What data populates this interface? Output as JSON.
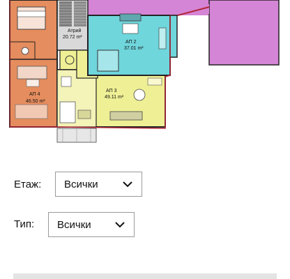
{
  "plan": {
    "rooms": [
      {
        "id": "stair",
        "name": "Атрий",
        "area": "20.72 m²"
      },
      {
        "id": "ap2",
        "name": "АП 2",
        "area": "37.01 m²"
      },
      {
        "id": "ap3",
        "name": "АП 3",
        "area": "49.11 m²"
      },
      {
        "id": "ap4",
        "name": "АП 4",
        "area": "46.50 m²"
      }
    ],
    "colors": {
      "orange": "#e58d5e",
      "pink": "#d585d6",
      "cyan": "#6fd6dc",
      "yellow": "#eff095",
      "wall": "#222222",
      "red_outline": "#b3283a",
      "stair": "#7d7d7d"
    }
  },
  "filters": {
    "floor": {
      "label": "Етаж:",
      "value": "Всички"
    },
    "type": {
      "label": "Тип:",
      "value": "Всички"
    }
  },
  "icons": {
    "dropdown": "chevron-down-icon"
  }
}
